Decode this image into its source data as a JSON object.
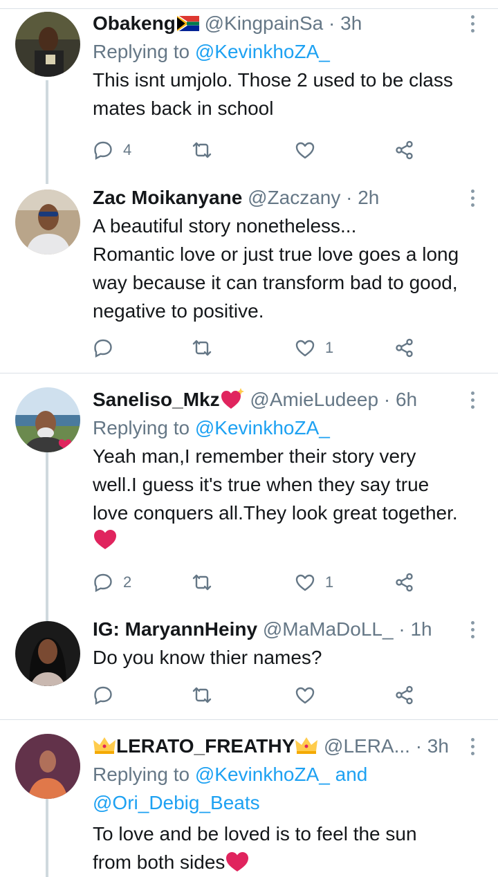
{
  "tweets": [
    {
      "name": "Obakeng",
      "handle": "@KingpainSa",
      "time": "· 3h",
      "replying_label": "Replying to",
      "replying_to": "@KevinkhoZA_",
      "lines": [
        "This isnt umjolo. Those 2 used to be class",
        "mates back in school"
      ],
      "reply_count": "4",
      "like_count": ""
    },
    {
      "name": "Zac Moikanyane",
      "handle": "@Zaczany",
      "time": "· 2h",
      "lines": [
        "A beautiful story nonetheless...",
        "Romantic love or just true love goes a long",
        "way because it can transform bad to good,",
        "negative to positive."
      ],
      "reply_count": "",
      "like_count": "1"
    },
    {
      "name": "Saneliso_Mkz",
      "handle": "@AmieLudeep",
      "time": "· 6h",
      "replying_label": "Replying to",
      "replying_to": "@KevinkhoZA_",
      "lines": [
        "Yeah man,I remember their story very",
        "well.I guess it's true when they say  true",
        "love conquers all.They look great together."
      ],
      "reply_count": "2",
      "like_count": "1"
    },
    {
      "name": "IG: MaryannHeiny",
      "handle": "@MaMaDoLL_",
      "time": "· 1h",
      "lines": [
        "Do you know thier names?"
      ],
      "reply_count": "",
      "like_count": ""
    },
    {
      "name": "LERATO_FREATHY",
      "handle": "@LERA...",
      "time": "· 3h",
      "replying_label": "Replying to",
      "replying_to": "@KevinkhoZA_ and",
      "replying_to_2": "@Ori_Debig_Beats",
      "lines": [
        "To love and be loved is to feel the sun",
        "from both sides"
      ]
    }
  ],
  "colors": {
    "link": "#1da1f2",
    "muted": "#657786",
    "heart": "#e0245e",
    "thread": "#cfd9de"
  }
}
